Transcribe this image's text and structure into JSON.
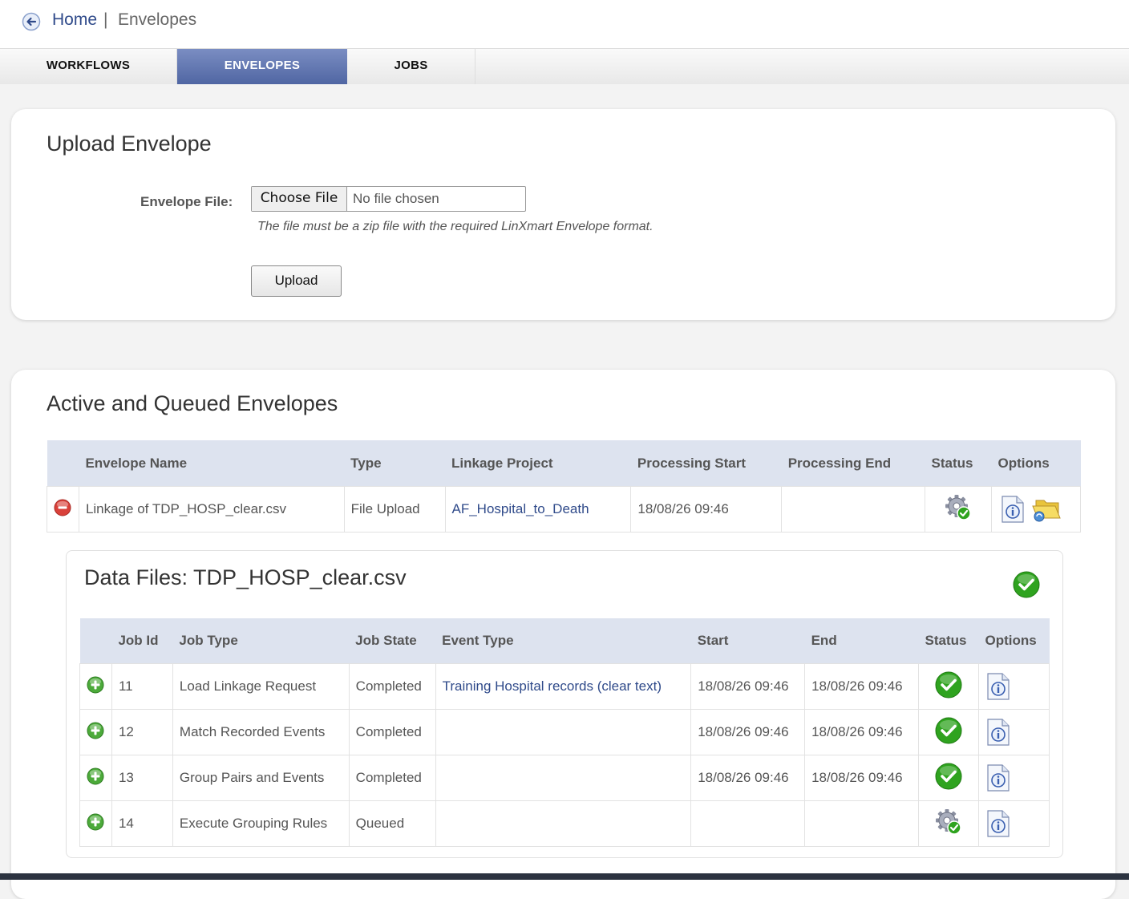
{
  "breadcrumb": {
    "home": "Home",
    "separator": "|",
    "current": "Envelopes"
  },
  "tabs": [
    {
      "label": "WORKFLOWS",
      "active": false
    },
    {
      "label": "ENVELOPES",
      "active": true
    },
    {
      "label": "JOBS",
      "active": false
    }
  ],
  "upload": {
    "title": "Upload Envelope",
    "file_label": "Envelope File:",
    "choose_button": "Choose File",
    "file_status": "No file chosen",
    "hint": "The file must be a zip file with the required LinXmart Envelope format.",
    "upload_button": "Upload"
  },
  "active": {
    "title": "Active and Queued Envelopes",
    "columns": [
      "Envelope Name",
      "Type",
      "Linkage Project",
      "Processing Start",
      "Processing End",
      "Status",
      "Options"
    ],
    "envelope": {
      "name": "Linkage of TDP_HOSP_clear.csv",
      "type": "File Upload",
      "project": "AF_Hospital_to_Death",
      "start": "18/08/26 09:46",
      "end": "",
      "status_icon": "gear-processing-icon"
    },
    "data_files": {
      "title": "Data Files: TDP_HOSP_clear.csv",
      "status_icon": "check-icon",
      "columns": [
        "Job Id",
        "Job Type",
        "Job State",
        "Event Type",
        "Start",
        "End",
        "Status",
        "Options"
      ],
      "jobs": [
        {
          "id": "11",
          "type": "Load Linkage Request",
          "state": "Completed",
          "event": "Training Hospital records (clear text)",
          "start": "18/08/26 09:46",
          "end": "18/08/26 09:46",
          "status": "completed"
        },
        {
          "id": "12",
          "type": "Match Recorded Events",
          "state": "Completed",
          "event": "",
          "start": "18/08/26 09:46",
          "end": "18/08/26 09:46",
          "status": "completed"
        },
        {
          "id": "13",
          "type": "Group Pairs and Events",
          "state": "Completed",
          "event": "",
          "start": "18/08/26 09:46",
          "end": "18/08/26 09:46",
          "status": "completed"
        },
        {
          "id": "14",
          "type": "Execute Grouping Rules",
          "state": "Queued",
          "event": "",
          "start": "",
          "end": "",
          "status": "queued"
        }
      ]
    }
  },
  "colors": {
    "accent": "#5066a3",
    "link": "#2f4a8a",
    "header_bg": "#dde3ef",
    "success": "#2fa31f",
    "danger": "#d9413a"
  }
}
